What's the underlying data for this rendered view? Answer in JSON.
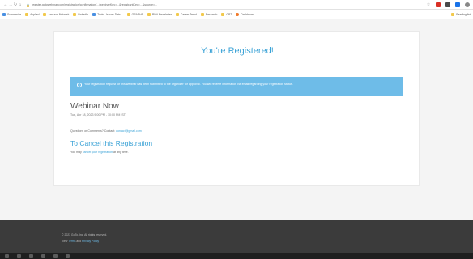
{
  "browser": {
    "url": "register.gotowebinar.com/registration/confirmation/.../webinarKey=...&registrantKey=...&source=...",
    "nav_glyphs": [
      "←",
      "→",
      "↻",
      "⌂"
    ],
    "bookmarks": [
      {
        "label": "Summarize"
      },
      {
        "label": "Applied"
      },
      {
        "label": "Amazon Network"
      },
      {
        "label": "LinkedIn"
      },
      {
        "label": "Tools - Issues Dets..."
      },
      {
        "label": "GRAPHS"
      },
      {
        "label": "RNA Newsletter"
      },
      {
        "label": "Career Trend"
      },
      {
        "label": "Research"
      },
      {
        "label": "GPT"
      },
      {
        "label": "Dashboard..."
      }
    ],
    "bookmarks_right": "Reading list"
  },
  "page": {
    "title": "You're Registered!",
    "notice": "Your registration request for this webinar has been submitted to the organizer for approval. You will receive information via email regarding your registration status.",
    "webinar_title": "Webinar Now",
    "webinar_date": "Tue, Apr 18, 2023 9:00 PM - 10:00 PM IST",
    "questions_prefix": "Questions or Comments? Contact:",
    "questions_email": "contact@gmail.com",
    "cancel_heading": "To Cancel this Registration",
    "cancel_prefix": "You may",
    "cancel_link": "cancel your registration",
    "cancel_suffix": "at any time."
  },
  "footer": {
    "copyright": "© 2023 GoTo, Inc. All rights reserved.",
    "links_prefix": "View",
    "link_terms": "Terms",
    "link_and": "and",
    "link_privacy": "Privacy Policy"
  },
  "colors": {
    "accent": "#3aa2d6",
    "notice_bg": "#6ebce8",
    "footer_bg": "#3b3b3b"
  }
}
